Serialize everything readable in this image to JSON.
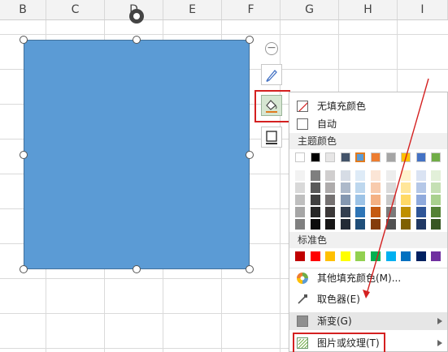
{
  "columns": [
    "B",
    "C",
    "D",
    "E",
    "F",
    "G",
    "H",
    "I"
  ],
  "menu": {
    "no_fill": "无填充颜色",
    "auto": "自动",
    "theme_colors_title": "主题颜色",
    "standard_colors_title": "标准色",
    "more_colors": "其他填充颜色(M)...",
    "eyedropper": "取色器(E)",
    "gradient": "渐变(G)",
    "picture_texture": "图片或纹理(T)"
  },
  "theme_base": [
    "#ffffff",
    "#000000",
    "#e7e6e6",
    "#44546a",
    "#5b9bd5",
    "#ed7d31",
    "#a5a5a5",
    "#ffc000",
    "#4472c4",
    "#70ad47"
  ],
  "theme_shades": [
    [
      "#f2f2f2",
      "#7f7f7f",
      "#d0cece",
      "#d6dce5",
      "#deebf7",
      "#fbe5d6",
      "#ededed",
      "#fff2cc",
      "#dae3f3",
      "#e2f0d9"
    ],
    [
      "#d9d9d9",
      "#595959",
      "#aeabab",
      "#adb9ca",
      "#bdd7ee",
      "#f8cbad",
      "#dbdbdb",
      "#ffe699",
      "#b4c7e7",
      "#c5e0b4"
    ],
    [
      "#bfbfbf",
      "#3f3f3f",
      "#757171",
      "#8497b0",
      "#9dc3e6",
      "#f4b183",
      "#c9c9c9",
      "#ffd966",
      "#8faadc",
      "#a9d18e"
    ],
    [
      "#a6a6a6",
      "#262626",
      "#3b3838",
      "#333f50",
      "#2e75b6",
      "#c55a11",
      "#7b7b7b",
      "#bf9000",
      "#2f5597",
      "#548235"
    ],
    [
      "#808080",
      "#0d0d0d",
      "#171616",
      "#222a35",
      "#1f4e79",
      "#843c0c",
      "#525252",
      "#7f6000",
      "#203864",
      "#385723"
    ]
  ],
  "standard": [
    "#c00000",
    "#ff0000",
    "#ffc000",
    "#ffff00",
    "#92d050",
    "#00b050",
    "#00b0f0",
    "#0070c0",
    "#002060",
    "#7030a0"
  ],
  "shape_fill": "#5b9bd5",
  "annotation_color": "#d42020"
}
